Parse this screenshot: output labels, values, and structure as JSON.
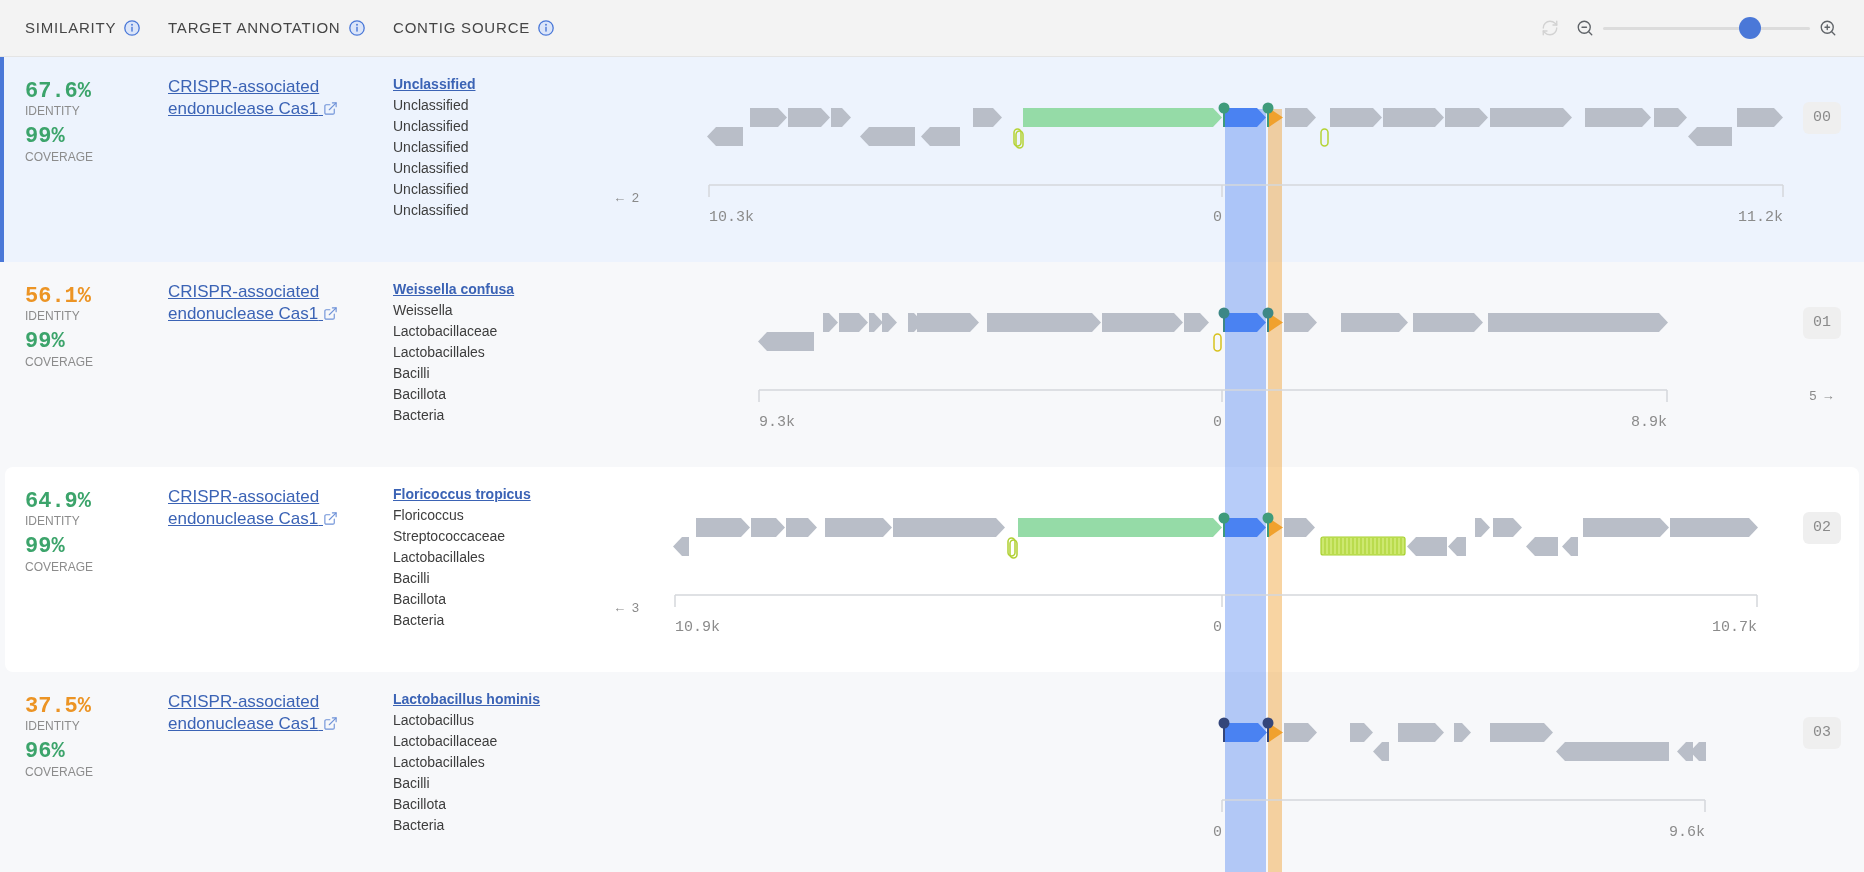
{
  "header": {
    "columns": [
      {
        "label": "SIMILARITY"
      },
      {
        "label": "TARGET ANNOTATION"
      },
      {
        "label": "CONTIG SOURCE"
      }
    ],
    "refresh": {
      "disabled": true
    },
    "zoom": {
      "level": 0.71
    }
  },
  "rows": [
    {
      "selected": true,
      "hovered": false,
      "identity": {
        "value": "67.6%",
        "label": "IDENTITY",
        "color": "#3ca46b"
      },
      "coverage": {
        "value": "99%",
        "label": "COVERAGE",
        "color": "#3ca46b"
      },
      "annotation": "CRISPR-associated endonuclease Cas1",
      "source": {
        "name": "Unclassified",
        "lineage": [
          "Unclassified",
          "Unclassified",
          "Unclassified",
          "Unclassified",
          "Unclassified",
          "Unclassified"
        ]
      },
      "track": {
        "nav_left": "← 2",
        "axis": {
          "start": "10.3k",
          "zero": "0",
          "end": "11.2k"
        },
        "pins": {
          "color": "#3f9b7b"
        },
        "badge": "00"
      }
    },
    {
      "selected": false,
      "hovered": false,
      "identity": {
        "value": "56.1%",
        "label": "IDENTITY",
        "color": "#ec9424"
      },
      "coverage": {
        "value": "99%",
        "label": "COVERAGE",
        "color": "#3ca46b"
      },
      "annotation": "CRISPR-associated endonuclease Cas1",
      "source": {
        "name": "Weissella confusa",
        "lineage": [
          "Weissella",
          "Lactobacillaceae",
          "Lactobacillales",
          "Bacilli",
          "Bacillota",
          "Bacteria"
        ]
      },
      "track": {
        "nav_right": "5 →",
        "axis": {
          "start": "9.3k",
          "zero": "0",
          "end": "8.9k"
        },
        "pins": {
          "color": "#3d8786"
        },
        "badge": "01"
      }
    },
    {
      "selected": false,
      "hovered": true,
      "identity": {
        "value": "64.9%",
        "label": "IDENTITY",
        "color": "#3ca46b"
      },
      "coverage": {
        "value": "99%",
        "label": "COVERAGE",
        "color": "#3ca46b"
      },
      "annotation": "CRISPR-associated endonuclease Cas1",
      "source": {
        "name": "Floricoccus tropicus",
        "lineage": [
          "Floricoccus",
          "Streptococcaceae",
          "Lactobacillales",
          "Bacilli",
          "Bacillota",
          "Bacteria"
        ]
      },
      "track": {
        "nav_left": "← 3",
        "axis": {
          "start": "10.9k",
          "zero": "0",
          "end": "10.7k"
        },
        "pins": {
          "color": "#3f9b7b"
        },
        "badge": "02"
      }
    },
    {
      "selected": false,
      "hovered": false,
      "identity": {
        "value": "37.5%",
        "label": "IDENTITY",
        "color": "#ec9424"
      },
      "coverage": {
        "value": "96%",
        "label": "COVERAGE",
        "color": "#3ca46b"
      },
      "annotation": "CRISPR-associated endonuclease Cas1",
      "source": {
        "name": "Lactobacillus hominis",
        "lineage": [
          "Lactobacillus",
          "Lactobacillaceae",
          "Lactobacillales",
          "Bacilli",
          "Bacillota",
          "Bacteria"
        ]
      },
      "track": {
        "axis": {
          "zero": "0",
          "end": "9.6k"
        },
        "pins": {
          "color": "#34467a"
        },
        "badge": "03"
      }
    }
  ]
}
